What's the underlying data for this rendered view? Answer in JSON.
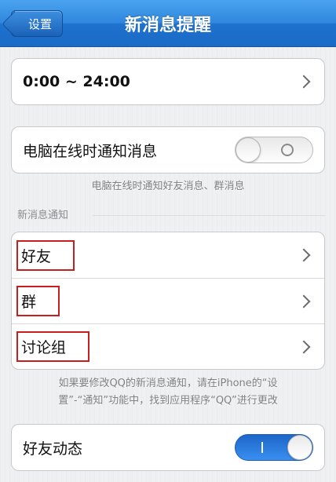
{
  "navbar": {
    "back_label": "设置",
    "title": "新消息提醒"
  },
  "time_range": {
    "label": "0:00 ~ 24:00"
  },
  "pc_online": {
    "label": "电脑在线时通知消息",
    "toggle_on": false,
    "note": "电脑在线时通知好友消息、群消息"
  },
  "notifications": {
    "section_label": "新消息通知",
    "items": [
      {
        "label": "好友"
      },
      {
        "label": "群"
      },
      {
        "label": "讨论组"
      }
    ],
    "note_line1": "如果要修改QQ的新消息通知，请在iPhone的“设",
    "note_line2": "置”-“通知”功能中，找到应用程序“QQ”进行更改"
  },
  "friend_feed": {
    "label": "好友动态",
    "toggle_on": true
  },
  "colors": {
    "accent": "#2f86de",
    "highlight_box": "#c81e1e"
  }
}
